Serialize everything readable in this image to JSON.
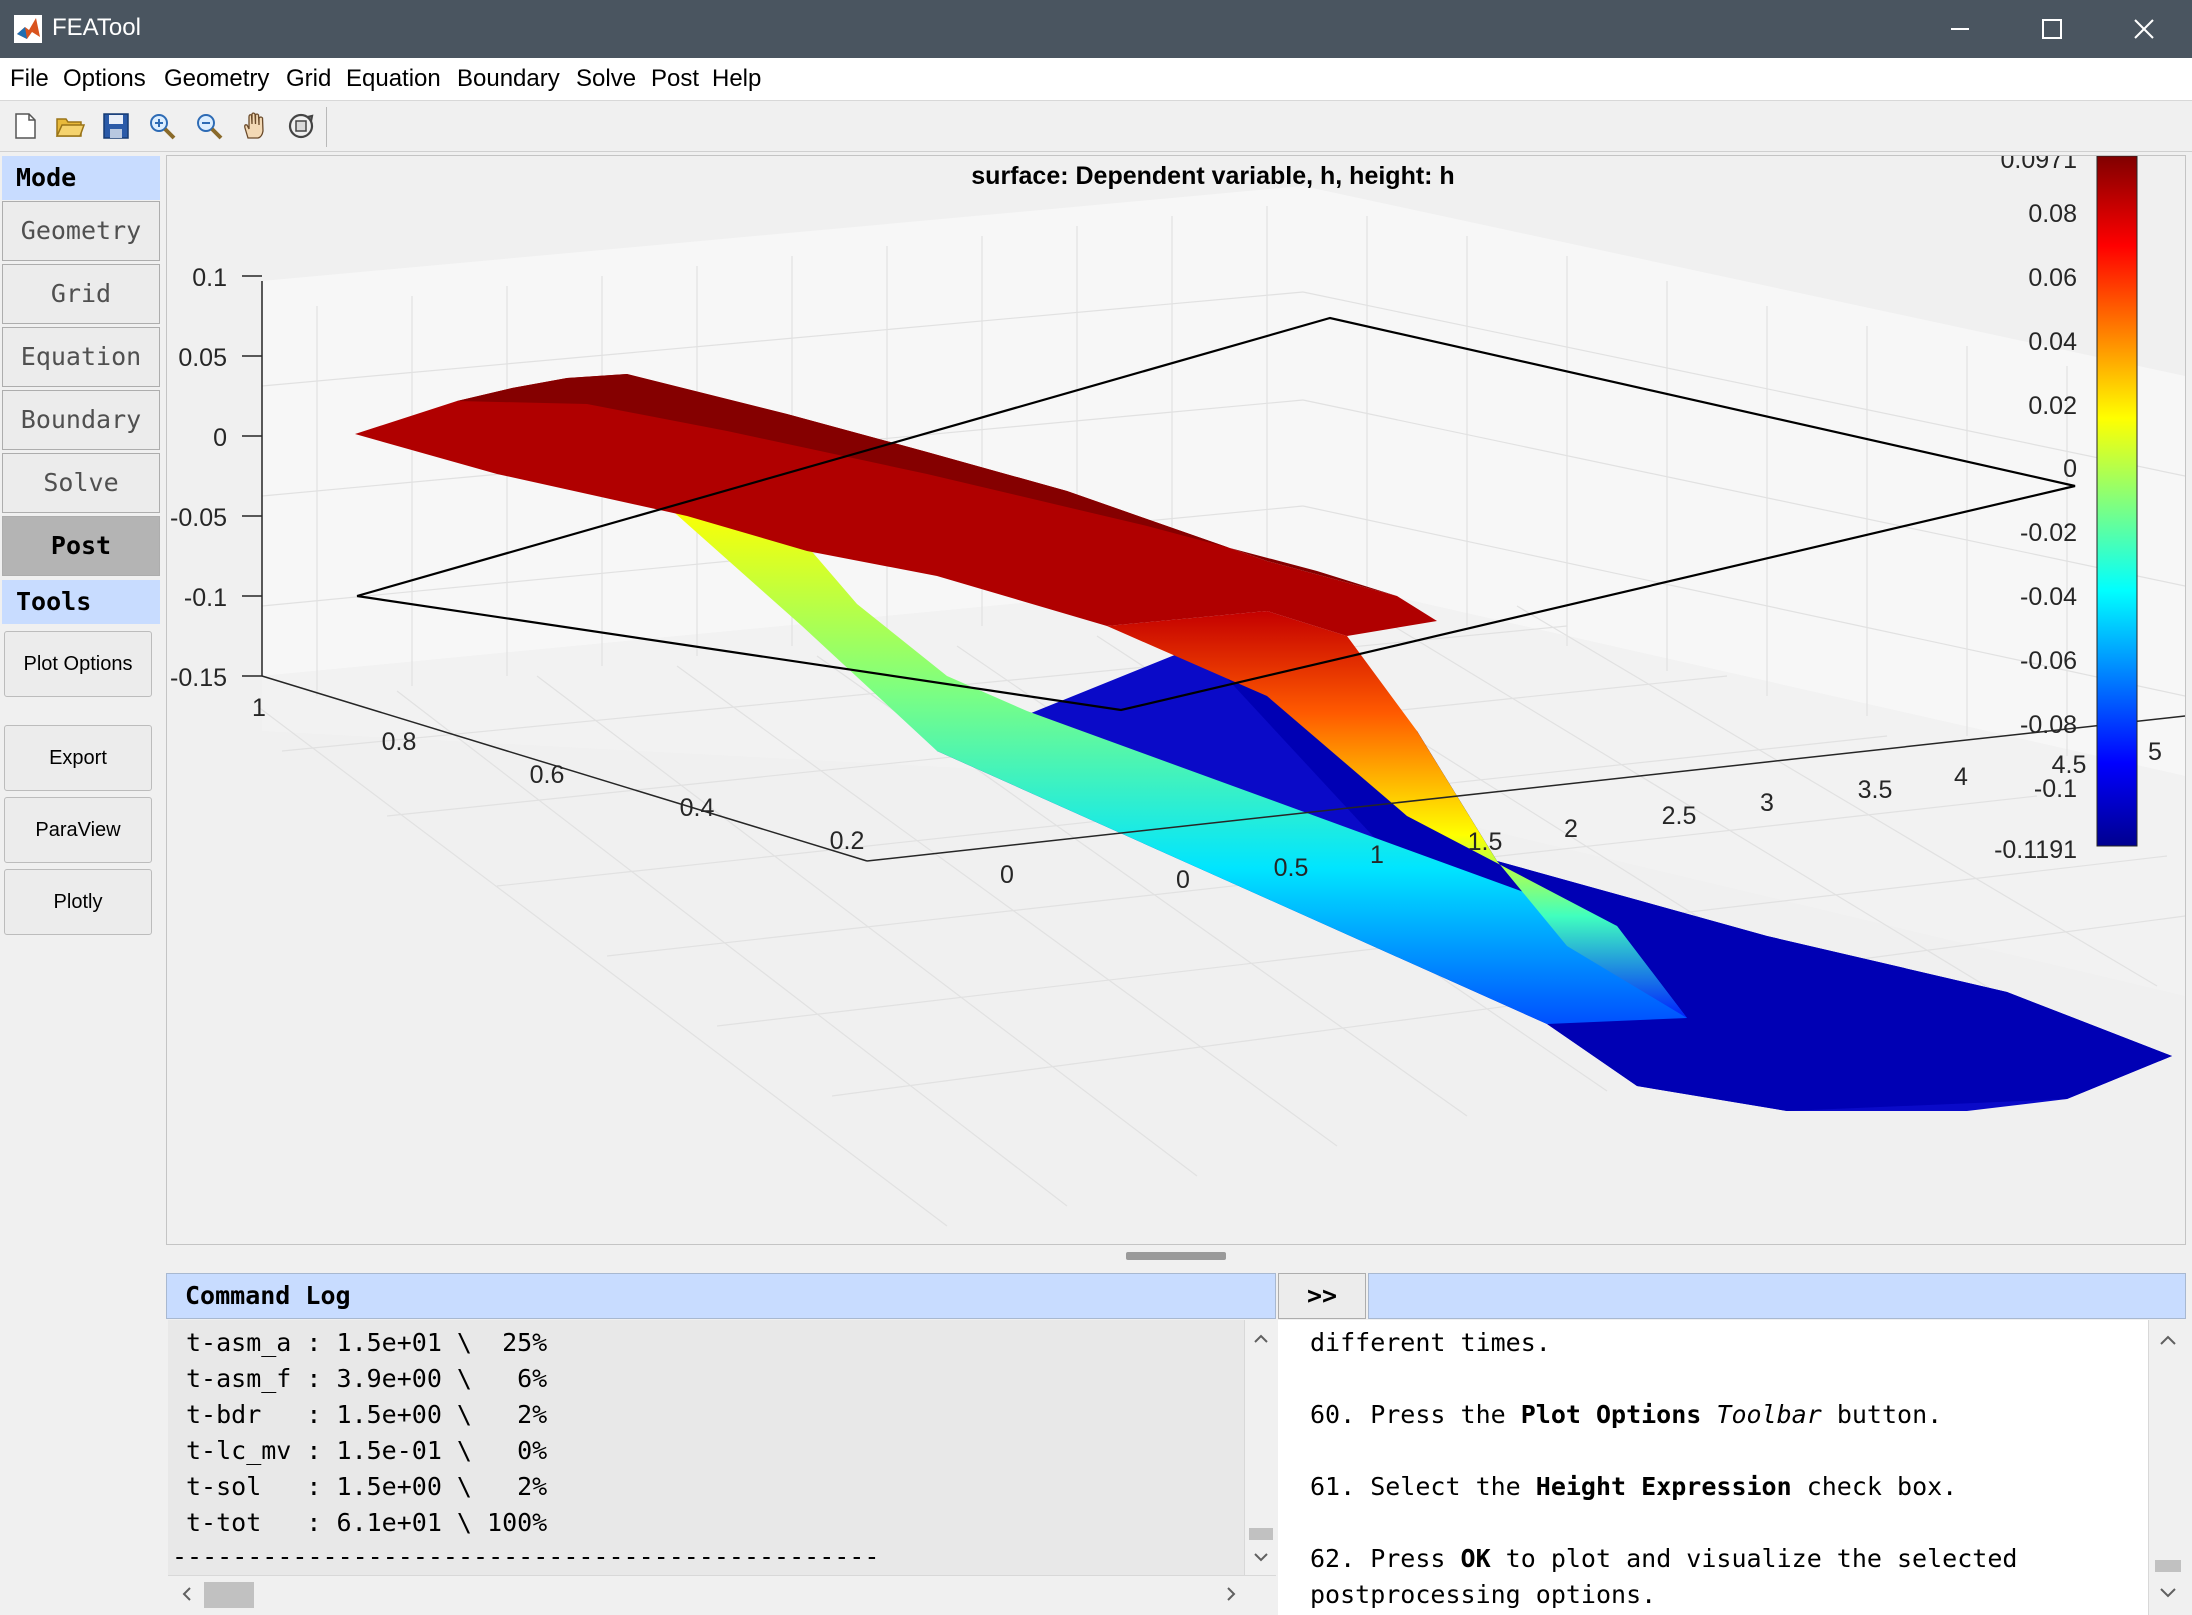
{
  "window": {
    "title": "FEATool",
    "icon": "matlab-icon",
    "controls": [
      "minimize-icon",
      "maximize-icon",
      "close-icon"
    ]
  },
  "menu": {
    "items": [
      "File",
      "Options",
      "Geometry",
      "Grid",
      "Equation",
      "Boundary",
      "Solve",
      "Post",
      "Help"
    ]
  },
  "toolbar": {
    "icons": [
      "new-file-icon",
      "open-folder-icon",
      "save-icon",
      "zoom-in-icon",
      "zoom-out-icon",
      "pan-hand-icon",
      "rotate-3d-icon"
    ]
  },
  "sidebar": {
    "mode_header": "Mode",
    "modes": [
      "Geometry",
      "Grid",
      "Equation",
      "Boundary",
      "Solve",
      "Post"
    ],
    "active_mode": "Post",
    "tools_header": "Tools",
    "tools": [
      "Plot Options",
      "Export",
      "ParaView",
      "Plotly"
    ]
  },
  "plot": {
    "title": "surface: Dependent variable, h, height: h",
    "z_ticks": [
      "0.1",
      "0.05",
      "0",
      "-0.05",
      "-0.1",
      "-0.15"
    ],
    "y_ticks": [
      "1",
      "0.8",
      "0.6",
      "0.4",
      "0.2",
      "0"
    ],
    "x_ticks": [
      "0",
      "0.5",
      "1",
      "1.5",
      "2",
      "2.5",
      "3",
      "3.5",
      "4",
      "4.5",
      "5"
    ],
    "colorbar": {
      "max_label": "0.0971",
      "min_label": "-0.1191",
      "ticks": [
        "0.08",
        "0.06",
        "0.04",
        "0.02",
        "0",
        "-0.02",
        "-0.04",
        "-0.06",
        "-0.08",
        "-0.1"
      ],
      "colormap": "jet",
      "colors": [
        "#00008f",
        "#0000ff",
        "#00ffff",
        "#ffff00",
        "#ff0000",
        "#800000"
      ]
    }
  },
  "command_log": {
    "title": "Command Log",
    "expand_label": ">>",
    "lines": [
      "t-asm_a : 1.5e+01 \\  25%",
      "t-asm_f : 3.9e+00 \\   6%",
      "t-bdr   : 1.5e+00 \\   2%",
      "t-lc_mv : 1.5e-01 \\   0%",
      "t-sol   : 1.5e+00 \\   2%",
      "t-tot   : 6.1e+01 \\ 100%",
      "-----------------------------------------------"
    ]
  },
  "help": {
    "line1": "different times.",
    "step60": {
      "a": "60. Press the ",
      "b": "Plot Options",
      "c": " ",
      "d": "Toolbar",
      "e": " button."
    },
    "step61": {
      "a": "61. Select the ",
      "b": "Height Expression",
      "c": " check box."
    },
    "step62": {
      "a": "62. Press ",
      "b": "OK",
      "c": " to plot and visualize the selected"
    },
    "line_last": "postprocessing options."
  }
}
